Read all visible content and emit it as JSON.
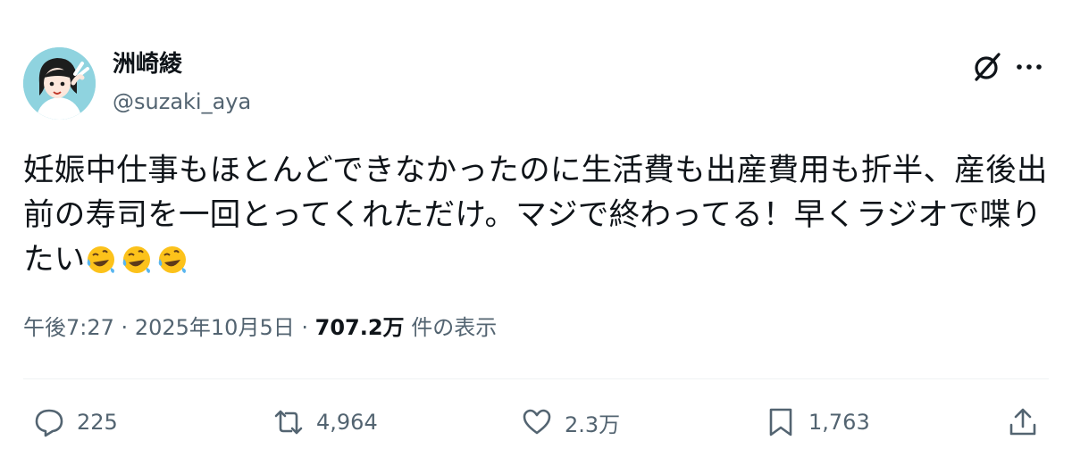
{
  "user": {
    "display_name": "洲崎綾",
    "handle": "@suzaki_aya"
  },
  "tweet": {
    "lines": [
      "妊娠中仕事もほとんどできなかったのに生活費も出産費用も折半、産後出",
      "前の寿司を一回とってくれただけ。マジで終わってる！早くラジオで喋り",
      "たい"
    ],
    "emojis": [
      "rolling-on-floor-laughing-icon",
      "rolling-on-floor-laughing-icon",
      "rolling-on-floor-laughing-icon"
    ]
  },
  "meta": {
    "time": "午後7:27",
    "sep1": "·",
    "date": "2025年10月5日",
    "sep2": "·",
    "views": "707.2万",
    "views_label": "件の表示"
  },
  "actions": {
    "replies": "225",
    "reposts": "4,964",
    "likes": "2.3万",
    "bookmarks": "1,763"
  },
  "colors": {
    "text": "#0f1419",
    "secondary": "#536471",
    "avatar_bg": "#8fd3df"
  }
}
